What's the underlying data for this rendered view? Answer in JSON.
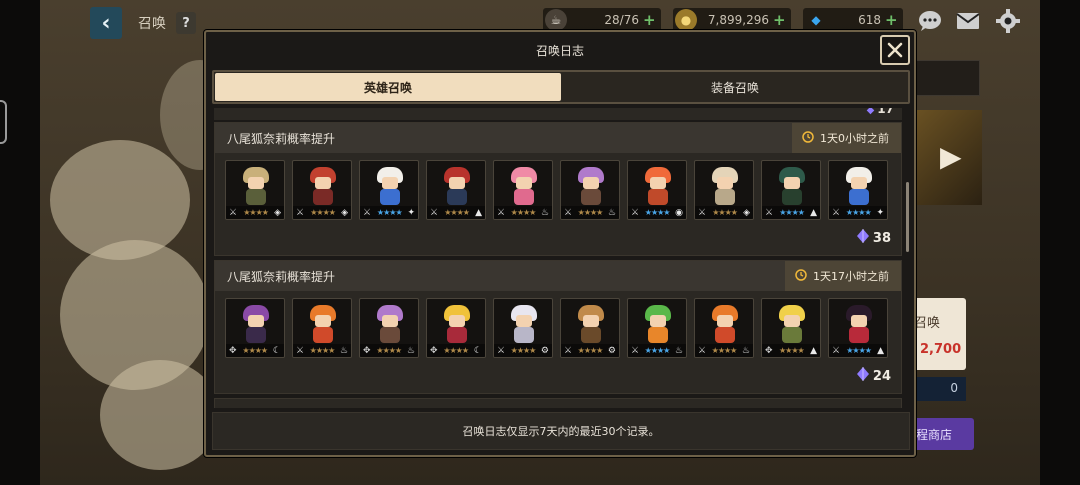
{
  "topbar": {
    "title": "召唤",
    "help_label": "?",
    "stamina": "28/76",
    "gold": "7,899,296",
    "gems": "618",
    "plus": "+"
  },
  "side": {
    "card_text": "召唤",
    "card_price": "2,700",
    "zero": "0",
    "shop": "程商店"
  },
  "modal": {
    "title": "召唤日志",
    "tabs": [
      {
        "label": "英雄召唤",
        "active": true
      },
      {
        "label": "装备召唤",
        "active": false
      }
    ],
    "prev_count": "17",
    "records": [
      {
        "title": "八尾狐奈莉概率提升",
        "time": "1天0小时之前",
        "count": "38",
        "heroes": [
          {
            "hair": "#c9b07a",
            "body": "#5a5f3a",
            "role": "⚔",
            "stars": "★★★★",
            "blue": false,
            "elem": "◈"
          },
          {
            "hair": "#c2412f",
            "body": "#7a2a26",
            "role": "⚔",
            "stars": "★★★★",
            "blue": false,
            "elem": "◈"
          },
          {
            "hair": "#f2efe9",
            "body": "#3c6fd0",
            "role": "⚔",
            "stars": "★★★★",
            "blue": true,
            "elem": "✦"
          },
          {
            "hair": "#b8332c",
            "body": "#2b3a58",
            "role": "⚔",
            "stars": "★★★★",
            "blue": false,
            "elem": "▲"
          },
          {
            "hair": "#f08aa6",
            "body": "#e06a8e",
            "role": "⚔",
            "stars": "★★★★",
            "blue": false,
            "elem": "♨"
          },
          {
            "hair": "#b07acb",
            "body": "#6a4a3a",
            "role": "⚔",
            "stars": "★★★★",
            "blue": false,
            "elem": "♨"
          },
          {
            "hair": "#f06a3a",
            "body": "#c04a2a",
            "role": "⚔",
            "stars": "★★★★",
            "blue": true,
            "elem": "◉"
          },
          {
            "hair": "#e4d4b8",
            "body": "#b8a88a",
            "role": "⚔",
            "stars": "★★★★",
            "blue": false,
            "elem": "◈"
          },
          {
            "hair": "#2e5a4a",
            "body": "#28402e",
            "role": "⚔",
            "stars": "★★★★",
            "blue": true,
            "elem": "▲"
          },
          {
            "hair": "#f2efe9",
            "body": "#3c6fd0",
            "role": "⚔",
            "stars": "★★★★",
            "blue": true,
            "elem": "✦"
          }
        ]
      },
      {
        "title": "八尾狐奈莉概率提升",
        "time": "1天17小时之前",
        "count": "24",
        "heroes": [
          {
            "hair": "#8a4aa6",
            "body": "#3a2a4a",
            "role": "✥",
            "stars": "★★★★",
            "blue": false,
            "elem": "☾"
          },
          {
            "hair": "#e87a2a",
            "body": "#d04a2a",
            "role": "⚔",
            "stars": "★★★★",
            "blue": false,
            "elem": "♨"
          },
          {
            "hair": "#b07acb",
            "body": "#6a4a3a",
            "role": "✥",
            "stars": "★★★★",
            "blue": false,
            "elem": "♨"
          },
          {
            "hair": "#f0c23a",
            "body": "#a82a3a",
            "role": "✥",
            "stars": "★★★★",
            "blue": false,
            "elem": "☾"
          },
          {
            "hair": "#e8e6f0",
            "body": "#b8b6c8",
            "role": "⚔",
            "stars": "★★★★",
            "blue": false,
            "elem": "⚙"
          },
          {
            "hair": "#c08a4a",
            "body": "#6a4a2a",
            "role": "⚔",
            "stars": "★★★★",
            "blue": false,
            "elem": "⚙"
          },
          {
            "hair": "#5ab84a",
            "body": "#e8862a",
            "role": "⚔",
            "stars": "★★★★",
            "blue": true,
            "elem": "♨"
          },
          {
            "hair": "#e87a2a",
            "body": "#d04a2a",
            "role": "⚔",
            "stars": "★★★★",
            "blue": false,
            "elem": "♨"
          },
          {
            "hair": "#f0d04a",
            "body": "#6a7a3a",
            "role": "✥",
            "stars": "★★★★",
            "blue": false,
            "elem": "▲"
          },
          {
            "hair": "#2a1a2a",
            "body": "#b82a3a",
            "role": "⚔",
            "stars": "★★★★",
            "blue": true,
            "elem": "▲"
          }
        ]
      }
    ],
    "footer": "召唤日志仅显示7天内的最近30个记录。"
  },
  "colors": {
    "accent_tab": "#f1ddbe",
    "modal_border": "#6e6148",
    "gem_purple": "#8f7bff",
    "price_red": "#c8322a"
  }
}
